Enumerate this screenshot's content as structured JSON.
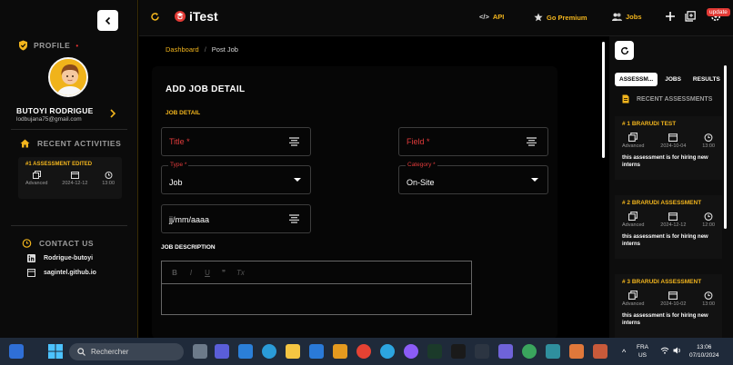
{
  "sidebar": {
    "profile_title": "PROFILE",
    "profile_dot": "•",
    "user_name": "BUTOYI RODRIGUE",
    "user_email": "lodbujana75@gmail.com",
    "recent_title": "RECENT ACTIVITIES",
    "activity": {
      "title": "#1 ASSESSMENT EDITED",
      "level": "Advanced",
      "date": "2024-12-12",
      "time": "13:00"
    },
    "contact_title": "CONTACT US",
    "contacts": [
      {
        "icon": "linkedin-icon",
        "label": "Rodrigue-butoyi"
      },
      {
        "icon": "globe-icon",
        "label": "sagintel.github.io"
      }
    ]
  },
  "topbar": {
    "logo": "iTest",
    "api_label": "API",
    "premium_label": "Go Premium",
    "jobs_label": "Jobs",
    "update_badge": "update"
  },
  "breadcrumb": {
    "root": "Dashboard",
    "separator": "/",
    "current": "Post Job"
  },
  "form": {
    "title": "ADD JOB DETAIL",
    "subtitle": "JOB DETAIL",
    "title_placeholder": "Title *",
    "field_placeholder": "Field *",
    "type_label": "Type *",
    "type_value": "Job",
    "category_label": "Category *",
    "category_value": "On-Site",
    "date_placeholder": "jj/mm/aaaa",
    "description_label": "JOB DESCRIPTION",
    "editor_tools": [
      "B",
      "I",
      "U",
      "❞",
      "Tx"
    ]
  },
  "right_panel": {
    "tabs": [
      "ASSESSM...",
      "JOBS",
      "RESULTS"
    ],
    "active_tab": 0,
    "recent_title": "RECENT ASSESSMENTS",
    "assessments": [
      {
        "title": "# 1 BRARUDI TEST",
        "level": "Advanced",
        "date": "2024-10-04",
        "time": "13:00",
        "desc": "this assessment is for hiring new interns"
      },
      {
        "title": "# 2 BRARUDI ASSESSMENT",
        "level": "Advanced",
        "date": "2024-12-12",
        "time": "12:00",
        "desc": "this assessment is for hiring new interns"
      },
      {
        "title": "# 3 BRARUDI ASSESSMENT",
        "level": "Advanced",
        "date": "2024-10-02",
        "time": "13:00",
        "desc": "this assessment is for hiring new interns"
      }
    ]
  },
  "taskbar": {
    "search_placeholder": "Rechercher",
    "lang_line1": "FRA",
    "lang_line2": "US",
    "time": "13:06",
    "date": "07/10/2024"
  },
  "colors": {
    "accent": "#f2b51d",
    "error": "#e03b3b",
    "badge": "#e23a35"
  }
}
